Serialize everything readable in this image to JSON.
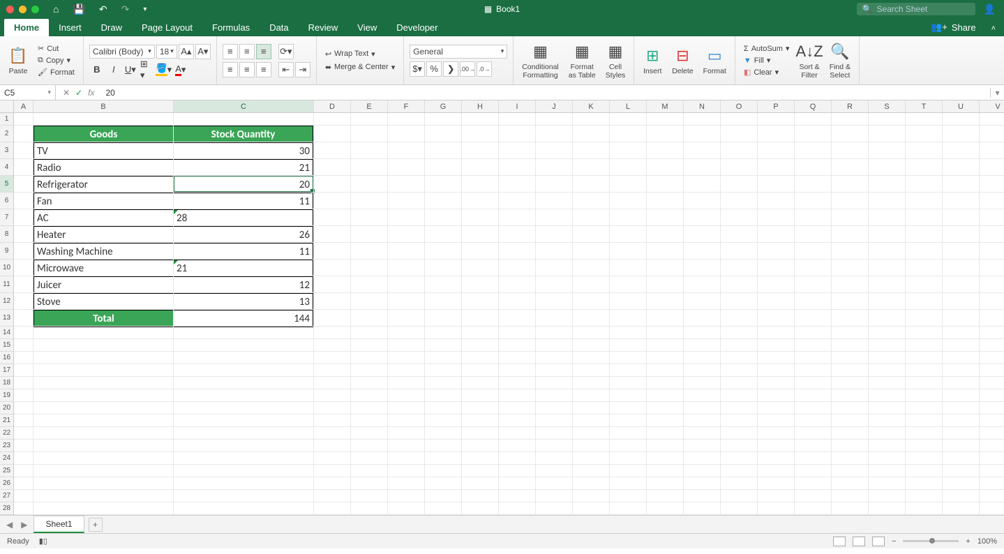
{
  "titlebar": {
    "doc_name": "Book1",
    "search_placeholder": "Search Sheet"
  },
  "menu": {
    "tabs": [
      "Home",
      "Insert",
      "Draw",
      "Page Layout",
      "Formulas",
      "Data",
      "Review",
      "View",
      "Developer"
    ],
    "active": "Home",
    "share": "Share"
  },
  "ribbon": {
    "paste": "Paste",
    "cut": "Cut",
    "copy": "Copy",
    "format_painter": "Format",
    "font_name": "Calibri (Body)",
    "font_size": "18",
    "wrap_text": "Wrap Text",
    "merge_center": "Merge & Center",
    "number_format": "General",
    "cond_fmt": "Conditional\nFormatting",
    "fmt_table": "Format\nas Table",
    "cell_styles": "Cell\nStyles",
    "insert": "Insert",
    "delete": "Delete",
    "format": "Format",
    "autosum": "AutoSum",
    "fill": "Fill",
    "clear": "Clear",
    "sort_filter": "Sort &\nFilter",
    "find_select": "Find &\nSelect"
  },
  "formula_bar": {
    "name_box": "C5",
    "formula": "20"
  },
  "columns": [
    "A",
    "B",
    "C",
    "D",
    "E",
    "F",
    "G",
    "H",
    "I",
    "J",
    "K",
    "L",
    "M",
    "N",
    "O",
    "P",
    "Q",
    "R",
    "S",
    "T",
    "U",
    "V"
  ],
  "col_widths": {
    "A": 28,
    "B": 201,
    "C": 201,
    "other": 53
  },
  "selected_col": "C",
  "row_count": 31,
  "tall_rows": [
    2,
    3,
    4,
    5,
    6,
    7,
    8,
    9,
    10,
    11,
    12,
    13
  ],
  "selected_row": 5,
  "table": {
    "headers": [
      "Goods",
      "Stock Quantity"
    ],
    "rows": [
      {
        "goods": "TV",
        "qty": "30",
        "align": "right",
        "mark": false
      },
      {
        "goods": "Radio",
        "qty": "21",
        "align": "right",
        "mark": false
      },
      {
        "goods": "Refrigerator",
        "qty": "20",
        "align": "right",
        "mark": false
      },
      {
        "goods": "Fan",
        "qty": "11",
        "align": "right",
        "mark": false
      },
      {
        "goods": "AC",
        "qty": "28",
        "align": "left",
        "mark": true
      },
      {
        "goods": "Heater",
        "qty": "26",
        "align": "right",
        "mark": false
      },
      {
        "goods": "Washing Machine",
        "qty": "11",
        "align": "right",
        "mark": false
      },
      {
        "goods": "Microwave",
        "qty": "21",
        "align": "left",
        "mark": true
      },
      {
        "goods": "Juicer",
        "qty": "12",
        "align": "right",
        "mark": false
      },
      {
        "goods": "Stove",
        "qty": "13",
        "align": "right",
        "mark": false
      }
    ],
    "total_label": "Total",
    "total_value": "144"
  },
  "sheet_tabs": {
    "active": "Sheet1"
  },
  "status": {
    "ready": "Ready",
    "zoom": "100%"
  }
}
